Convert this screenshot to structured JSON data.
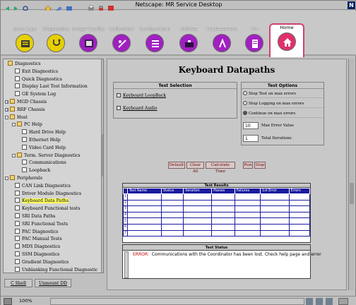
{
  "window": {
    "title": "Netscape: MR Service Desktop",
    "logo": "N"
  },
  "toolbar_icons": [
    "back-icon",
    "forward-icon",
    "reload-icon",
    "home-icon",
    "search-icon",
    "print-icon",
    "security-icon",
    "stop-icon"
  ],
  "tabs": [
    {
      "label": "Error Logs",
      "color": "#e6d000",
      "icon": "error-log-icon"
    },
    {
      "label": "Diagnostics",
      "color": "#e6d000",
      "icon": "stethoscope-icon"
    },
    {
      "label": "Image Quality",
      "color": "#a020c0",
      "icon": "image-quality-icon"
    },
    {
      "label": "Calibration",
      "color": "#a020c0",
      "icon": "calibration-icon"
    },
    {
      "label": "Configuration",
      "color": "#a020c0",
      "icon": "configuration-icon"
    },
    {
      "label": "Utilities",
      "color": "#a020c0",
      "icon": "utilities-icon"
    },
    {
      "label": "Replacement",
      "color": "#a020c0",
      "icon": "replacement-icon"
    },
    {
      "label": "PM",
      "color": "#a020c0",
      "icon": "pm-icon"
    },
    {
      "label": "Home",
      "color": "#e0306a",
      "icon": "home-icon"
    }
  ],
  "tree": [
    {
      "label": "Diagnostics",
      "type": "folder",
      "level": 0
    },
    {
      "label": "Exit Diagnostics",
      "type": "page",
      "level": 1
    },
    {
      "label": "Quick Diagnostics",
      "type": "page",
      "level": 1
    },
    {
      "label": "Display Last Test Information",
      "type": "page",
      "level": 1
    },
    {
      "label": "GE System Log",
      "type": "page",
      "level": 1
    },
    {
      "label": "MGD Chassis",
      "type": "folder",
      "level": 0,
      "expander": "+"
    },
    {
      "label": "RRF Chassis",
      "type": "folder",
      "level": 0,
      "expander": "+"
    },
    {
      "label": "Host",
      "type": "folder",
      "level": 0,
      "expander": "-"
    },
    {
      "label": "PC Help",
      "type": "folder",
      "level": 1,
      "expander": "-"
    },
    {
      "label": "Hard Drive Help",
      "type": "page",
      "level": 2
    },
    {
      "label": "Ethernet Help",
      "type": "page",
      "level": 2
    },
    {
      "label": "Video Card Help",
      "type": "page",
      "level": 2
    },
    {
      "label": "Term. Server Diagnostics",
      "type": "folder",
      "level": 1,
      "expander": "-"
    },
    {
      "label": "Communications",
      "type": "page",
      "level": 2
    },
    {
      "label": "Loopback",
      "type": "page",
      "level": 2
    },
    {
      "label": "Peripherals",
      "type": "folder",
      "level": 0,
      "expander": "-"
    },
    {
      "label": "CAN Link Diagnostics",
      "type": "page",
      "level": 1
    },
    {
      "label": "Driver Module Diagnostics",
      "type": "page",
      "level": 1
    },
    {
      "label": "Keyboard Data Paths",
      "type": "page",
      "level": 1,
      "selected": true
    },
    {
      "label": "Keyboard Functional tests",
      "type": "page",
      "level": 1
    },
    {
      "label": "SRI Data Paths",
      "type": "page",
      "level": 1
    },
    {
      "label": "SRI Functional Tests",
      "type": "page",
      "level": 1
    },
    {
      "label": "PAC Diagnostics",
      "type": "page",
      "level": 1
    },
    {
      "label": "PAC Manual Tests",
      "type": "page",
      "level": 1
    },
    {
      "label": "MDS Diagnostics",
      "type": "page",
      "level": 1
    },
    {
      "label": "SSM Diagnostics",
      "type": "page",
      "level": 1
    },
    {
      "label": "Gradient Diagnostics",
      "type": "page",
      "level": 1
    },
    {
      "label": "Unblanking Functional Diagnostic",
      "type": "page",
      "level": 1
    }
  ],
  "left_buttons": {
    "shell": "C Shell",
    "unmount": "Unmount DD"
  },
  "main": {
    "title": "Keyboard Datapaths",
    "test_selection": {
      "header": "Test Selection",
      "items": [
        "Keyboard LoopBack",
        "Keyboard Audio"
      ]
    },
    "test_options": {
      "header": "Test Options",
      "radios": [
        {
          "label": "Stop Test on max errors",
          "checked": false
        },
        {
          "label": "Stop Logging on max errors",
          "checked": false
        },
        {
          "label": "Continue on max errors",
          "checked": true
        }
      ],
      "max_error_value": "10",
      "max_error_label": "Max Error Value",
      "total_iterations": "1",
      "total_iterations_label": "Total Iterations"
    },
    "buttons": {
      "default": "Default",
      "clear_all": "Clear All",
      "calculate_time": "Calculate Time",
      "run": "Run",
      "stop": "Stop"
    },
    "results": {
      "header": "Test Results",
      "columns": [
        "Test Name",
        "Status",
        "Iteration",
        "Passes",
        "Failures",
        "1st Error",
        "Errors"
      ],
      "row_indexes": [
        "1",
        "2",
        "3",
        "4",
        "5",
        "6",
        "7"
      ]
    },
    "status": {
      "header": "Test Status",
      "error_label": "ERROR:",
      "message": "Communications with the Coordinator has been lost.  Check help page and error"
    }
  },
  "statusbar": {
    "zoom": "100%"
  }
}
